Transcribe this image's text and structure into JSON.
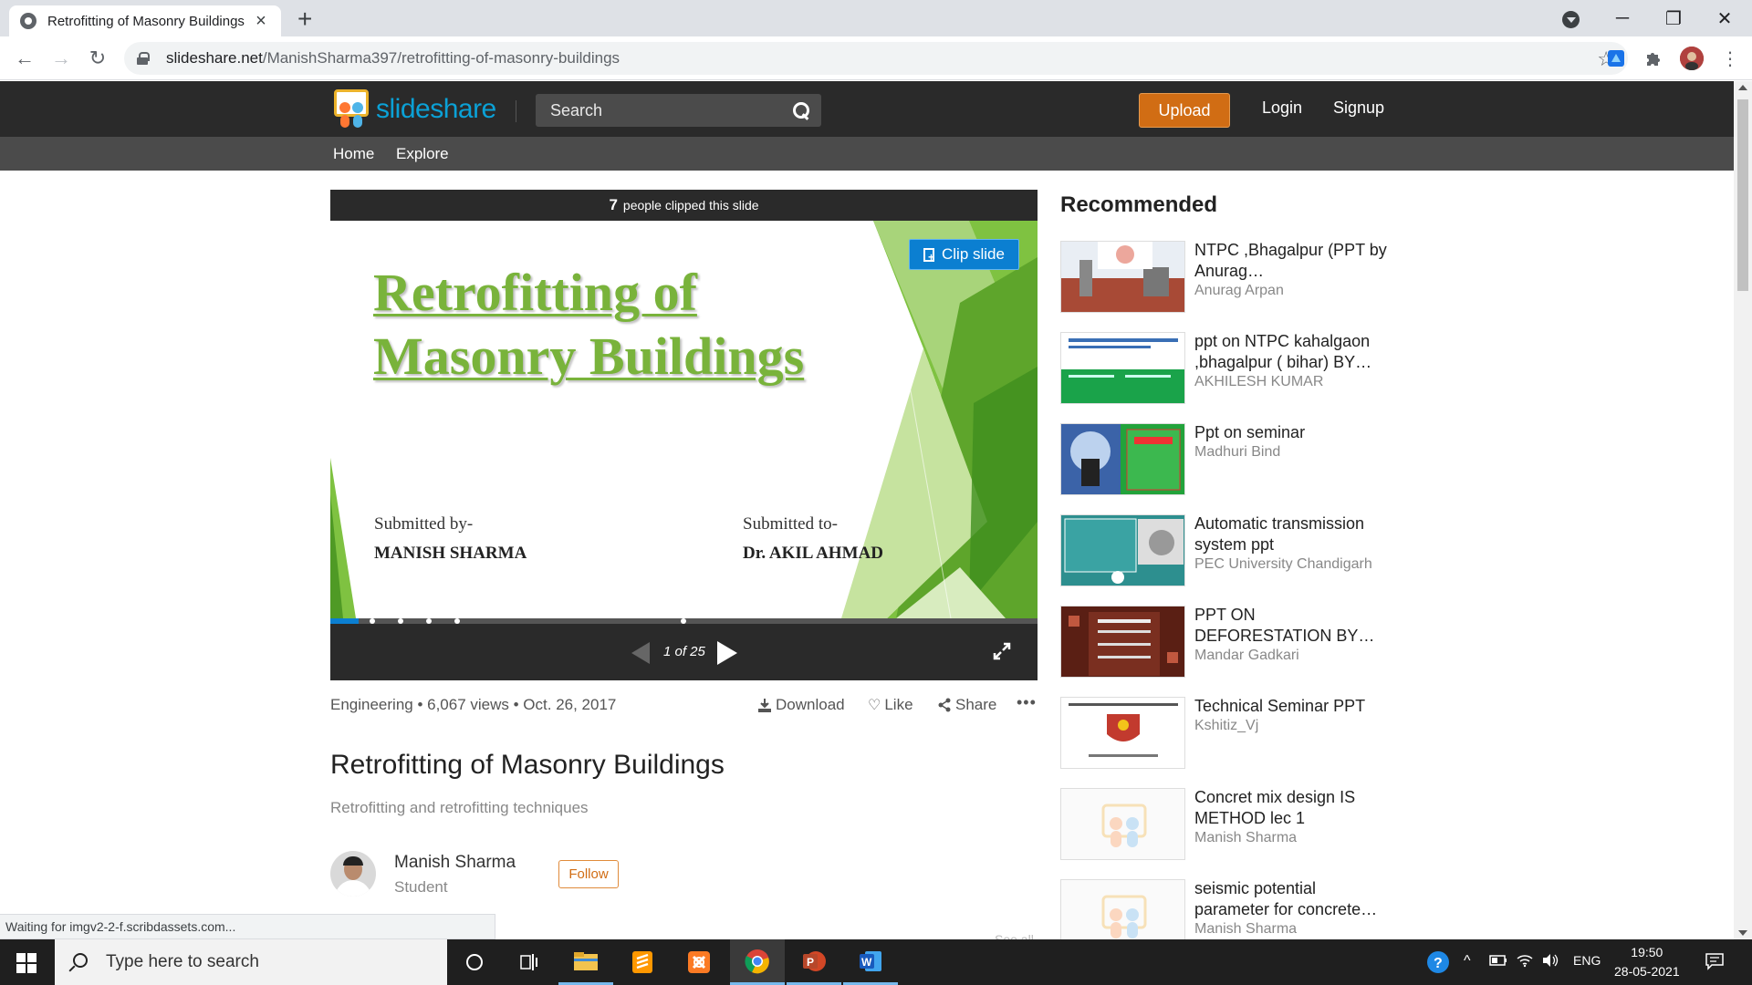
{
  "browser": {
    "tab_title": "Retrofitting of Masonry Buildings",
    "url_host": "slideshare.net",
    "url_path": "/ManishSharma397/retrofitting-of-masonry-buildings",
    "status_text": "Waiting for imgv2-2-f.scribdassets.com..."
  },
  "header": {
    "logo_text": "slideshare",
    "search_placeholder": "Search",
    "upload_label": "Upload",
    "login_label": "Login",
    "signup_label": "Signup"
  },
  "subnav": {
    "home": "Home",
    "explore": "Explore"
  },
  "player": {
    "clip_count": "7",
    "clip_text": "people clipped this slide",
    "clip_button": "Clip slide",
    "slide_title_line1": "Retrofitting of",
    "slide_title_line2": "Masonry Buildings",
    "submitted_by_label": "Submitted by-",
    "submitted_by_name": "MANISH SHARMA",
    "submitted_to_label": "Submitted to-",
    "submitted_to_name": "Dr. AKIL AHMAD",
    "page_indicator": "1 of 25",
    "current_page": 1,
    "total_pages": 25
  },
  "meta": {
    "info": "Engineering • 6,067 views • Oct. 26, 2017",
    "download": "Download",
    "like": "Like",
    "share": "Share",
    "more": "•••"
  },
  "doc": {
    "title": "Retrofitting of Masonry Buildings",
    "description": "Retrofitting and retrofitting techniques",
    "author_name": "Manish Sharma",
    "author_role": "Student",
    "follow_label": "Follow",
    "see_all": "See all"
  },
  "recommended": {
    "heading": "Recommended",
    "items": [
      {
        "title": "NTPC ,Bhagalpur (PPT by Anurag…",
        "author": "Anurag Arpan"
      },
      {
        "title": "ppt on NTPC kahalgaon ,bhagalpur ( bihar) BY…",
        "author": "AKHILESH KUMAR"
      },
      {
        "title": "Ppt on seminar",
        "author": "Madhuri Bind"
      },
      {
        "title": "Automatic transmission system ppt",
        "author": "PEC University Chandigarh"
      },
      {
        "title": "PPT ON DEFORESTATION BY…",
        "author": "Mandar Gadkari"
      },
      {
        "title": "Technical Seminar PPT",
        "author": "Kshitiz_Vj"
      },
      {
        "title": "Concret mix design IS METHOD lec 1",
        "author": "Manish Sharma"
      },
      {
        "title": "seismic potential parameter for concrete…",
        "author": "Manish Sharma"
      }
    ]
  },
  "taskbar": {
    "search_placeholder": "Type here to search",
    "lang": "ENG",
    "time": "19:50",
    "date": "28-05-2021"
  }
}
